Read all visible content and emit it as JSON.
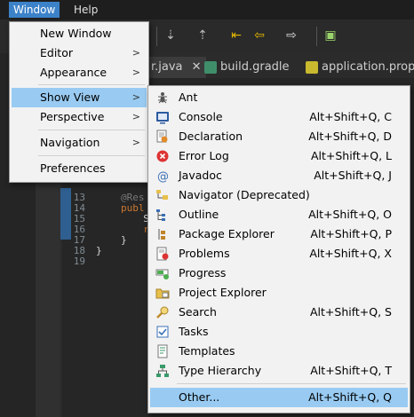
{
  "menubar": {
    "window": "Window",
    "help": "Help"
  },
  "tabs": [
    {
      "label": "r.java",
      "close": "✕",
      "color": "#d9a441"
    },
    {
      "label": "build.gradle",
      "color": "#3f8f6b"
    },
    {
      "label": "application.properti",
      "color": "#c8b92f"
    }
  ],
  "editor": {
    "line_numbers": [
      "13",
      "14",
      "15",
      "16",
      "17",
      "18",
      "19"
    ],
    "lines": [
      "@Res",
      "publ",
      "  S",
      "  r",
      "}",
      "}",
      ""
    ]
  },
  "window_menu": {
    "items": [
      {
        "label": "New Window",
        "submenu": false
      },
      {
        "label": "Editor",
        "submenu": true
      },
      {
        "label": "Appearance",
        "submenu": true
      },
      {
        "label": "Show View",
        "submenu": true,
        "highlighted": true
      },
      {
        "label": "Perspective",
        "submenu": true
      },
      {
        "label": "Navigation",
        "submenu": true
      },
      {
        "label": "Preferences",
        "submenu": false
      }
    ]
  },
  "show_view_menu": {
    "items": [
      {
        "label": "Ant",
        "shortcut": "",
        "icon": "ant-icon"
      },
      {
        "label": "Console",
        "shortcut": "Alt+Shift+Q, C",
        "icon": "console-icon"
      },
      {
        "label": "Declaration",
        "shortcut": "Alt+Shift+Q, D",
        "icon": "declaration-icon"
      },
      {
        "label": "Error Log",
        "shortcut": "Alt+Shift+Q, L",
        "icon": "error-log-icon"
      },
      {
        "label": "Javadoc",
        "shortcut": "Alt+Shift+Q, J",
        "icon": "javadoc-icon"
      },
      {
        "label": "Navigator (Deprecated)",
        "shortcut": "",
        "icon": "navigator-icon"
      },
      {
        "label": "Outline",
        "shortcut": "Alt+Shift+Q, O",
        "icon": "outline-icon"
      },
      {
        "label": "Package Explorer",
        "shortcut": "Alt+Shift+Q, P",
        "icon": "package-explorer-icon"
      },
      {
        "label": "Problems",
        "shortcut": "Alt+Shift+Q, X",
        "icon": "problems-icon"
      },
      {
        "label": "Progress",
        "shortcut": "",
        "icon": "progress-icon"
      },
      {
        "label": "Project Explorer",
        "shortcut": "",
        "icon": "project-explorer-icon"
      },
      {
        "label": "Search",
        "shortcut": "Alt+Shift+Q, S",
        "icon": "search-icon"
      },
      {
        "label": "Tasks",
        "shortcut": "",
        "icon": "tasks-icon"
      },
      {
        "label": "Templates",
        "shortcut": "",
        "icon": "templates-icon"
      },
      {
        "label": "Type Hierarchy",
        "shortcut": "Alt+Shift+Q, T",
        "icon": "type-hierarchy-icon"
      },
      {
        "label": "Other...",
        "shortcut": "Alt+Shift+Q, Q",
        "icon": "",
        "highlighted": true
      }
    ]
  },
  "colors": {
    "highlight": "#99cbf2",
    "menu_bg": "#f2f2f2",
    "ide_bg": "#2b2b2b"
  }
}
